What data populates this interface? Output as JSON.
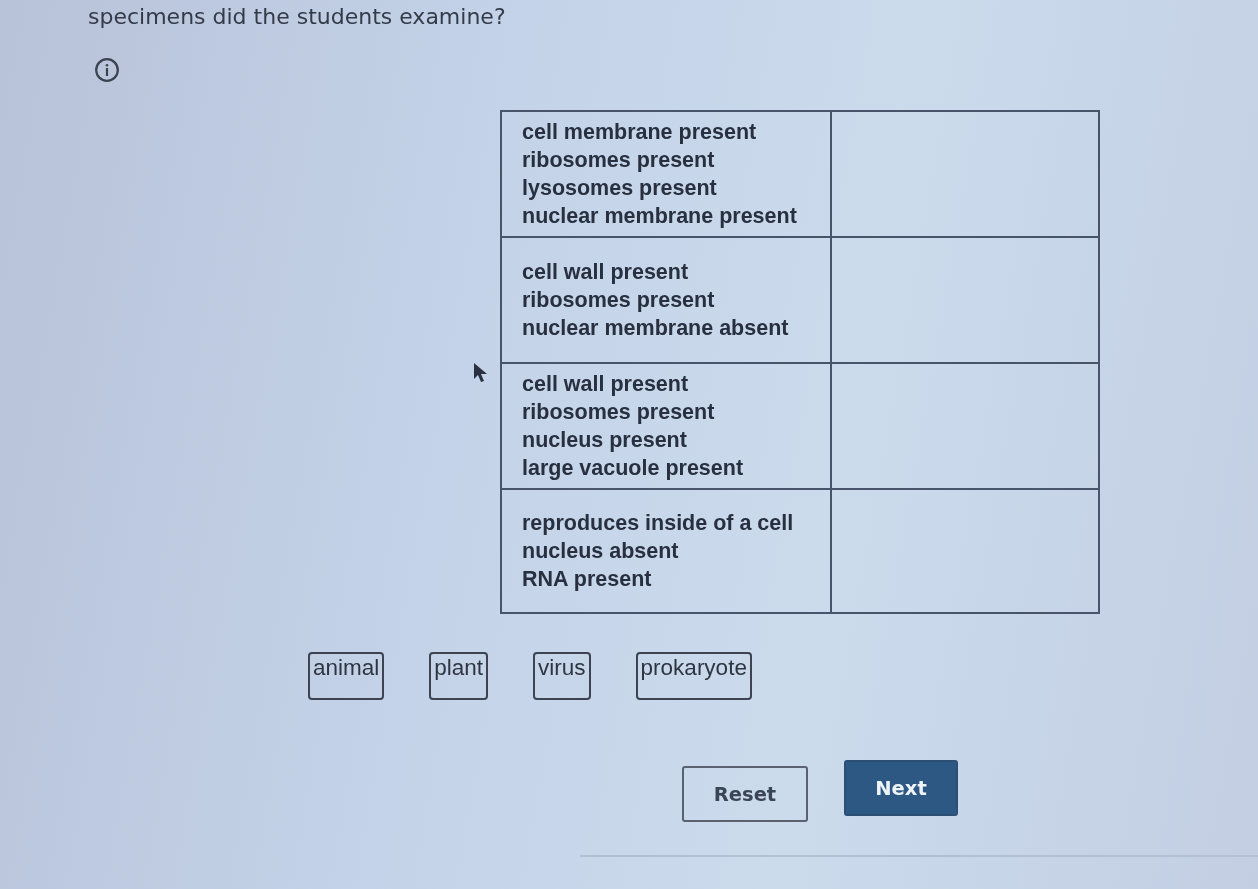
{
  "question": {
    "text": "specimens did the students examine?"
  },
  "table": {
    "rows": [
      {
        "traits": [
          "cell membrane present",
          "ribosomes present",
          "lysosomes present",
          "nuclear membrane present"
        ]
      },
      {
        "traits": [
          "cell wall present",
          "ribosomes present",
          "nuclear membrane absent"
        ]
      },
      {
        "traits": [
          "cell wall present",
          "ribosomes present",
          "nucleus present",
          "large vacuole present"
        ]
      },
      {
        "traits": [
          "reproduces inside of a cell",
          "nucleus absent",
          "RNA present"
        ]
      }
    ]
  },
  "choices": [
    {
      "label": "animal"
    },
    {
      "label": "plant"
    },
    {
      "label": "virus"
    },
    {
      "label": "prokaryote"
    }
  ],
  "buttons": [
    {
      "label": "Reset",
      "kind": "secondary"
    },
    {
      "label": "Next",
      "kind": "primary"
    }
  ]
}
